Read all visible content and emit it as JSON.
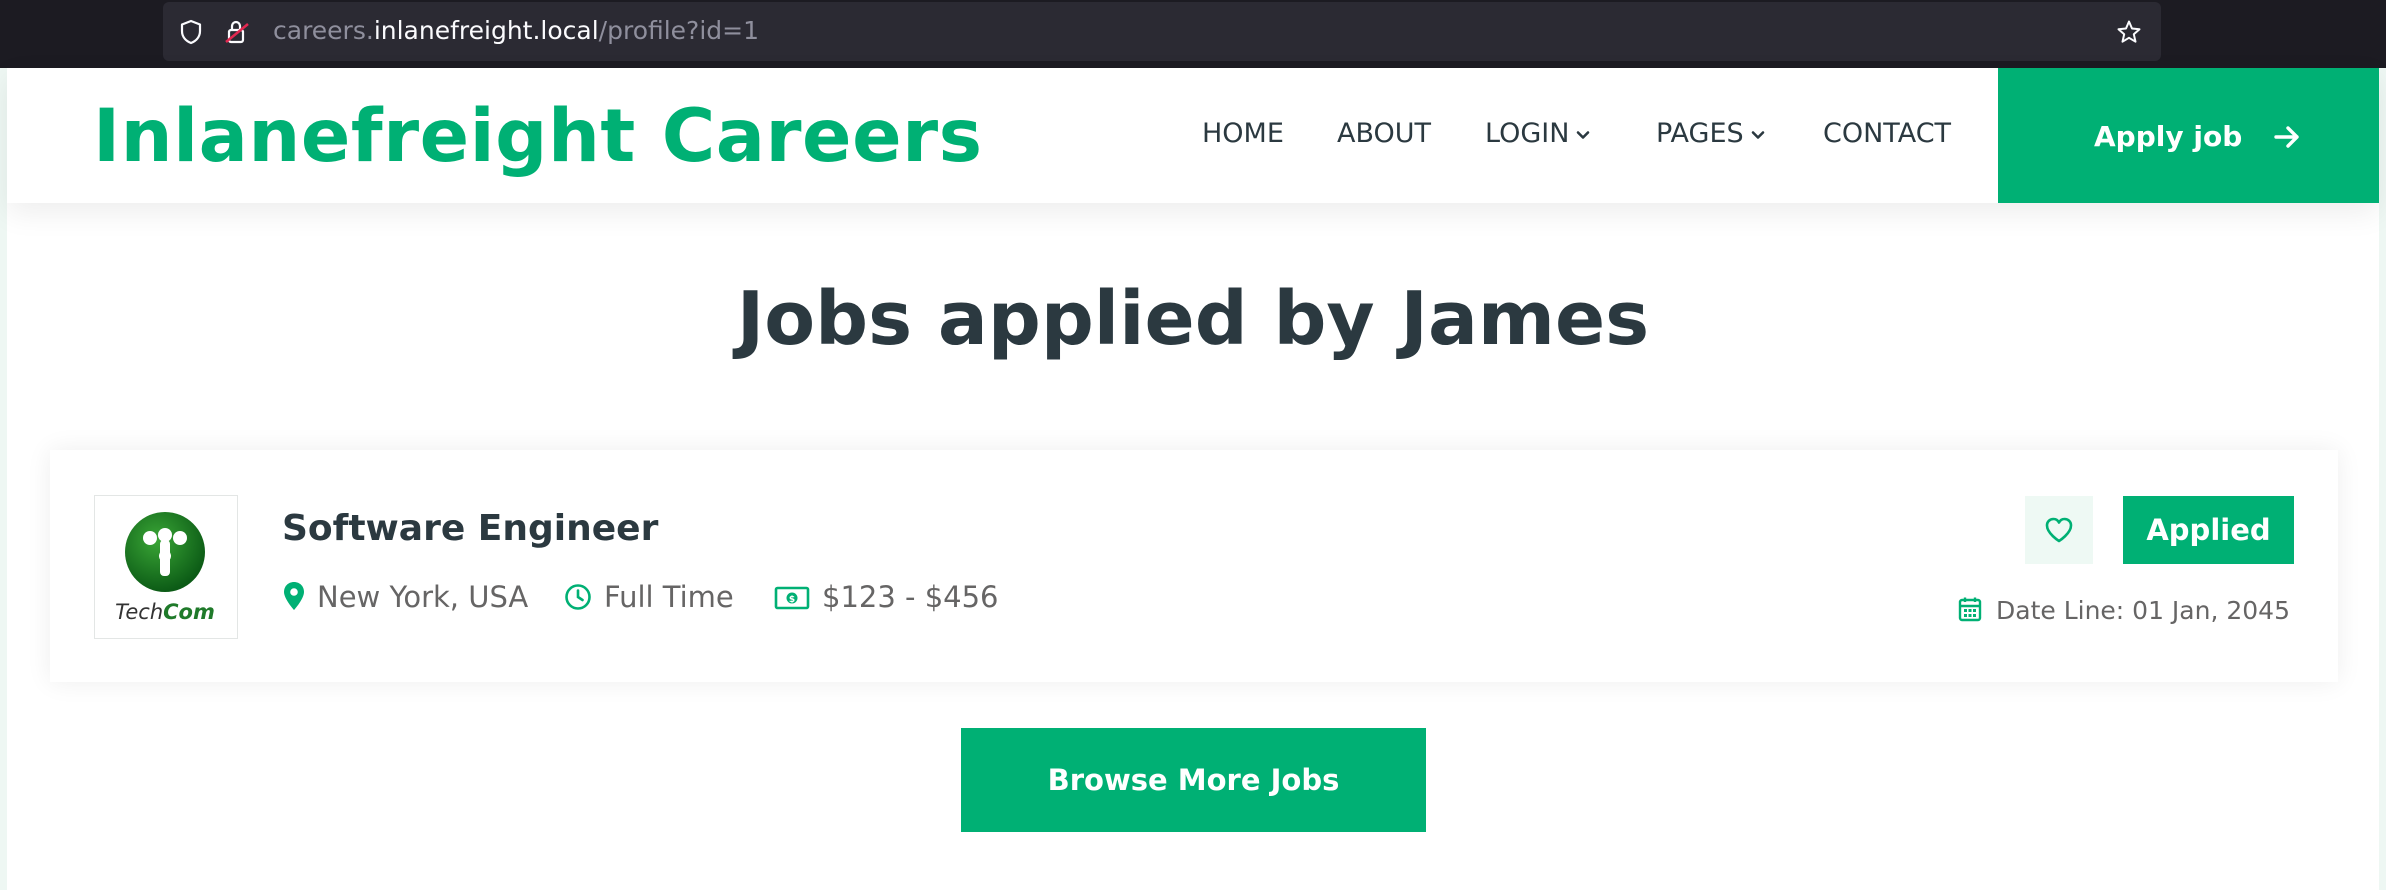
{
  "browser": {
    "url_subdomain": "careers.",
    "url_host": "inlanefreight.local",
    "url_path": "/profile?id=1"
  },
  "header": {
    "logo": "Inlanefreight Careers",
    "nav": [
      {
        "label": "HOME",
        "dropdown": false
      },
      {
        "label": "ABOUT",
        "dropdown": false
      },
      {
        "label": "LOGIN",
        "dropdown": true
      },
      {
        "label": "PAGES",
        "dropdown": true
      },
      {
        "label": "CONTACT",
        "dropdown": false
      }
    ],
    "apply_button": "Apply job"
  },
  "main": {
    "heading": "Jobs applied by James",
    "jobs": [
      {
        "company_logo_text": "TechCom",
        "title": "Software Engineer",
        "location": "New York, USA",
        "type": "Full Time",
        "salary": "$123 - $456",
        "status_button": "Applied",
        "deadline": "Date Line: 01 Jan, 2045"
      }
    ],
    "browse_button": "Browse More Jobs"
  },
  "colors": {
    "brand": "#00b074",
    "text_dark": "#2b3940",
    "text_muted": "#666565",
    "browser_chrome": "#1c1b22"
  }
}
